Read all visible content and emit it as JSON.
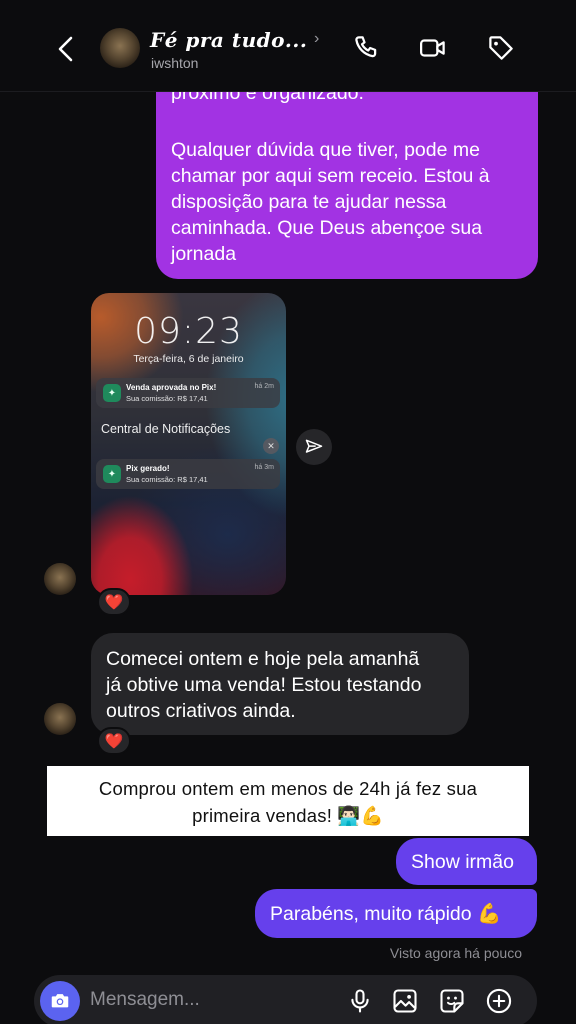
{
  "header": {
    "name": "𝑭é 𝒑𝒓𝒂 𝒕𝒖𝒅𝒐...",
    "username": "iwshton",
    "chevron": "›"
  },
  "messages": {
    "outgoing_top": {
      "partial_line": "próximo e organizado.",
      "text": "Qualquer dúvida que tiver, pode me\nchamar por aqui sem receio. Estou à\ndisposição para te ajudar nessa\ncaminhada. Que Deus abençoe sua\njornada"
    },
    "screenshot": {
      "time": "09:23",
      "date": "Terça-feira, 6 de janeiro",
      "notification_center": "Central de Notificações",
      "notifications": [
        {
          "title": "Venda aprovada no Pix!",
          "body": "Sua comissão: R$ 17,41",
          "time": "há 2m"
        },
        {
          "title": "Pix gerado!",
          "body": "Sua comissão: R$ 17,41",
          "time": "há 3m"
        }
      ],
      "reaction": "❤️"
    },
    "incoming": {
      "text": "Comecei ontem e hoje pela amanhã\njá obtive uma venda! Estou testando\noutros criativos ainda.",
      "reaction": "❤️"
    },
    "caption": {
      "line1": "Comprou ontem em menos de 24h já fez sua",
      "line2": "primeira vendas! 👨🏻‍💻💪"
    },
    "outgoing_1": "Show irmão",
    "outgoing_2": "Parabéns, muito rápido 💪",
    "seen": "Visto agora há pouco"
  },
  "composer": {
    "placeholder": "Mensagem..."
  },
  "icons": {
    "back": "chevron-left-icon",
    "call": "phone-icon",
    "video": "video-camera-icon",
    "tag": "tag-icon",
    "share": "send-icon",
    "camera": "camera-icon",
    "mic": "microphone-icon",
    "gallery": "image-icon",
    "sticker": "sticker-icon",
    "add": "plus-circle-icon"
  },
  "colors": {
    "outgoing_purple": "#a233e3",
    "outgoing_blue": "#6640ec",
    "incoming_grey": "#262629",
    "camera_button": "#5b63f0"
  }
}
